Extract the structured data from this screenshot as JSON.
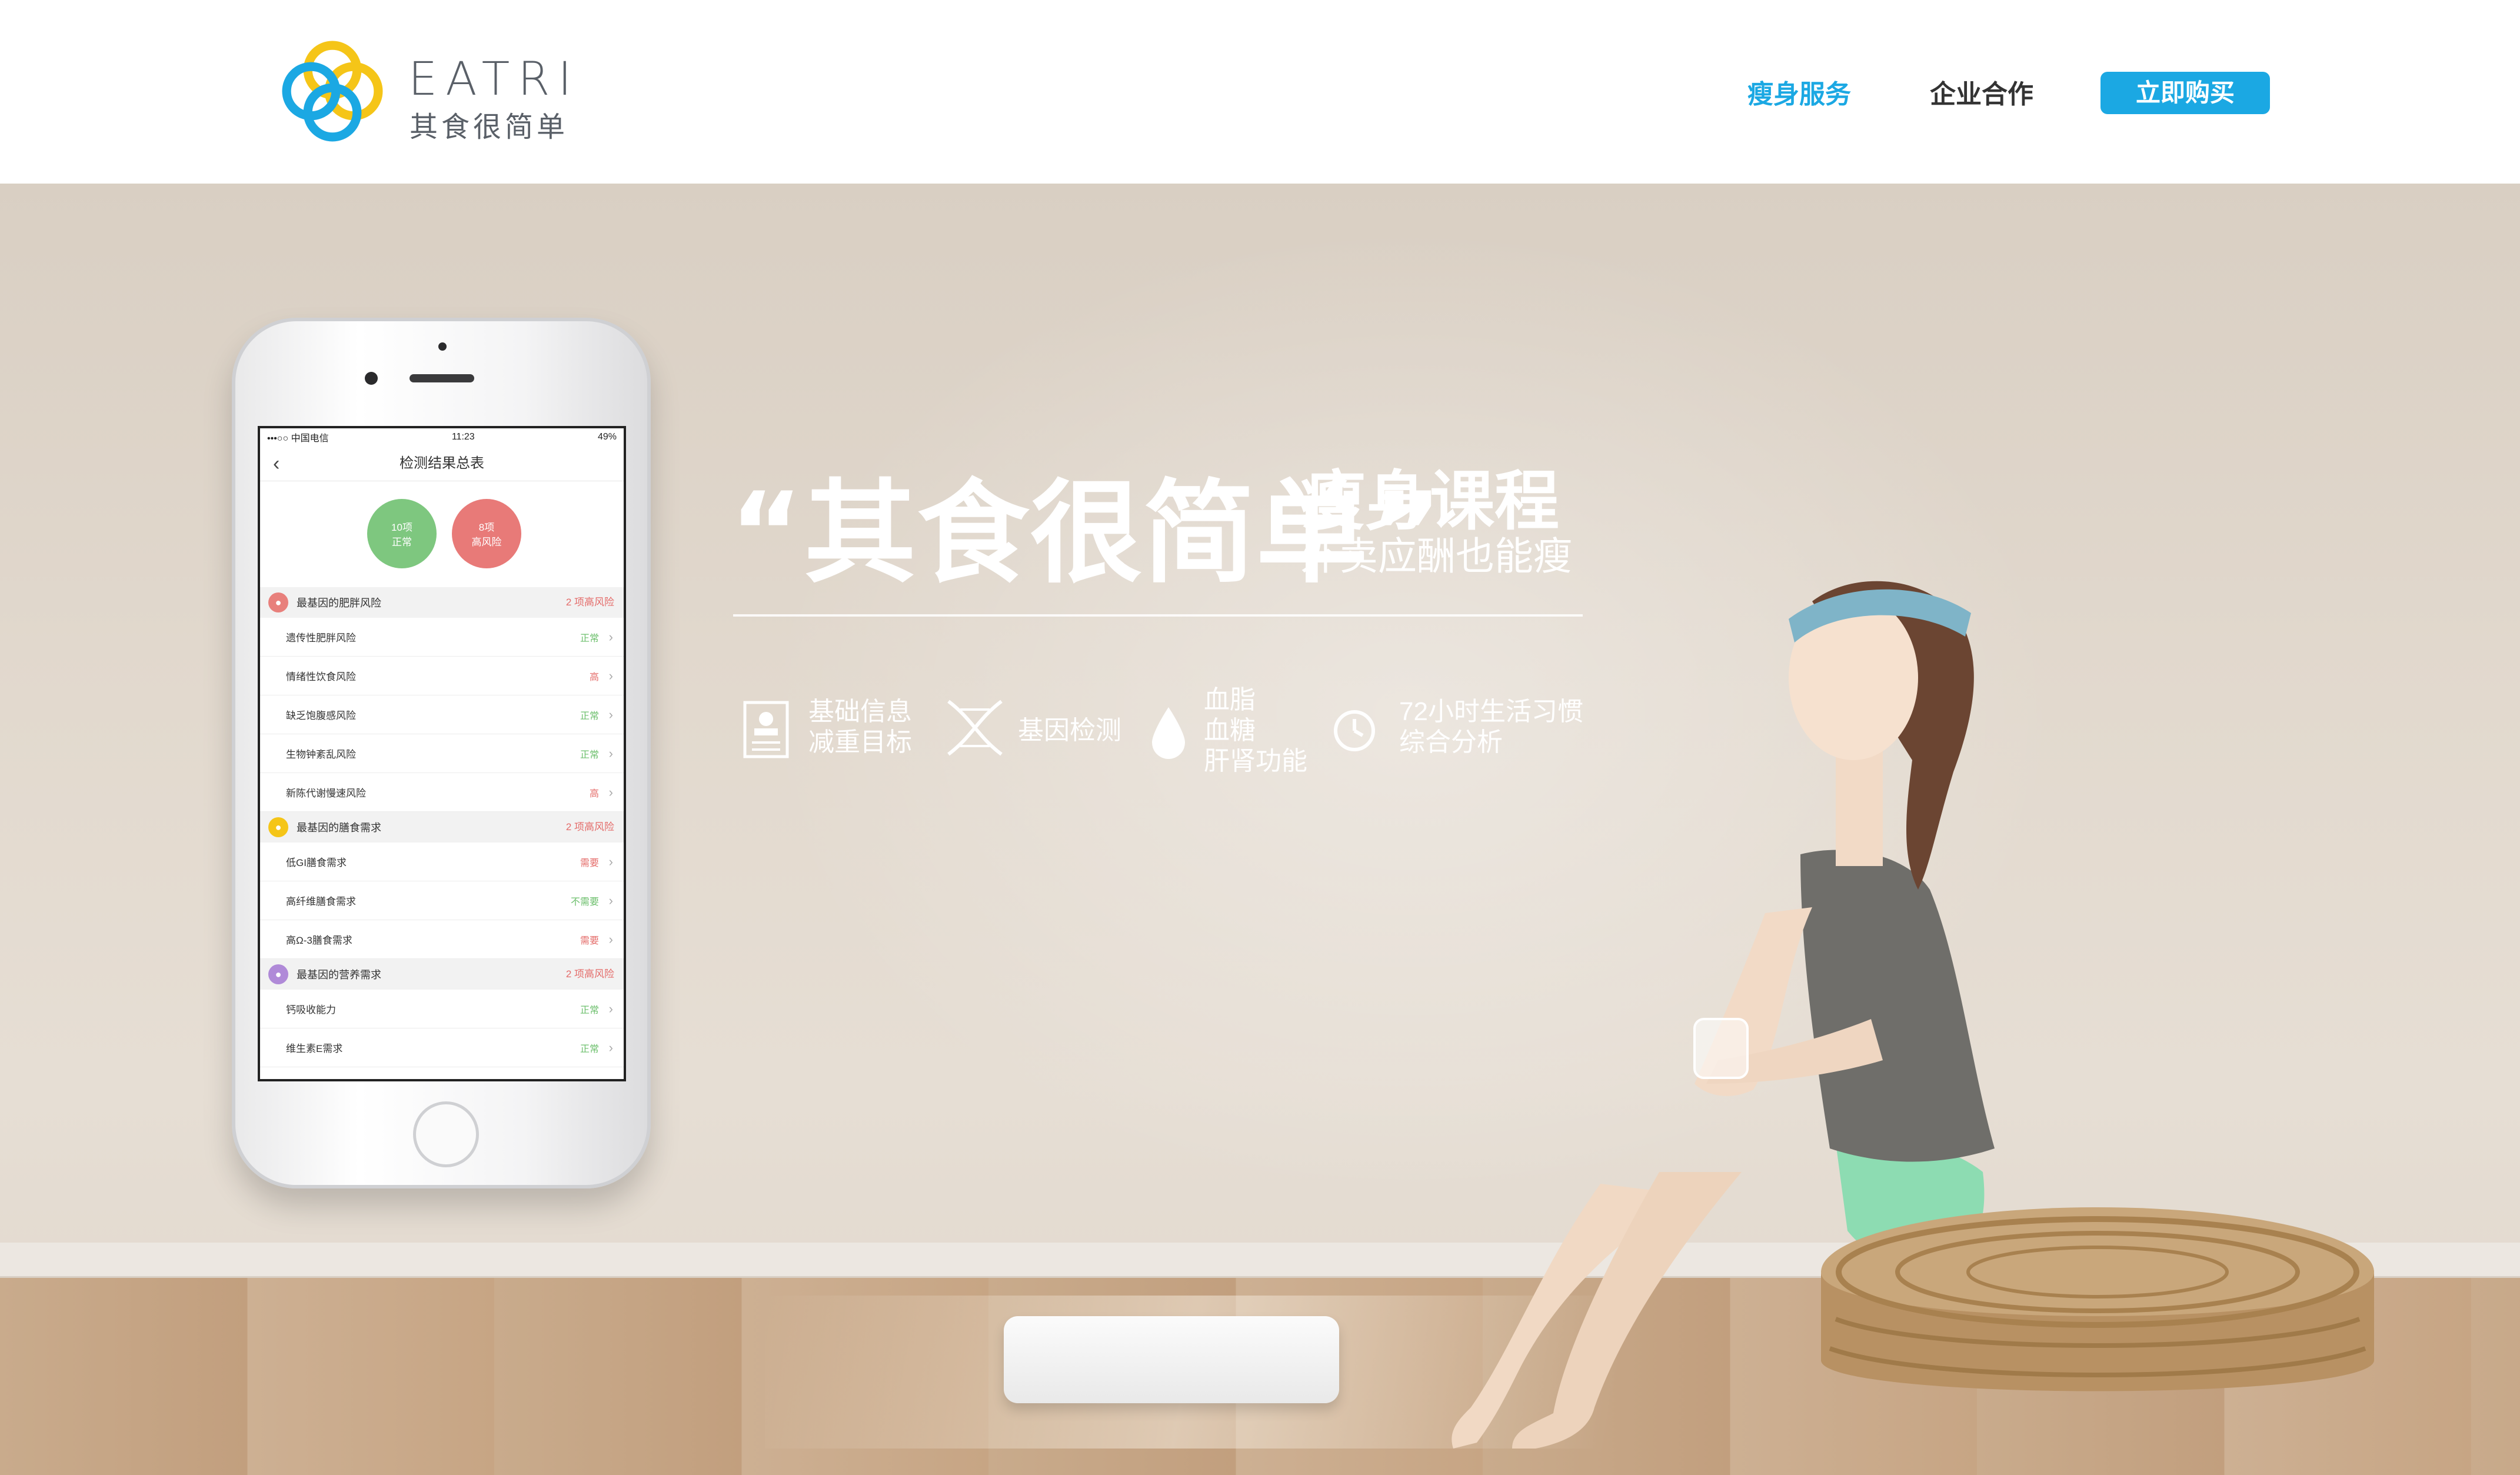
{
  "brand": {
    "name": "EATRI",
    "tagline_cn": "其食很简单",
    "colors": {
      "yellow": "#f5c518",
      "blue": "#1ba8e3"
    }
  },
  "nav": {
    "items": [
      {
        "label": "瘦身服务",
        "active": true
      },
      {
        "label": "企业合作",
        "active": false
      }
    ],
    "buy_button": "立即购买"
  },
  "hero": {
    "headline": "“其食很简单”",
    "course": "瘦身课程",
    "subline": "外卖应酬也能瘦",
    "features": [
      {
        "icon": "profile-card-icon",
        "lines": [
          "基础信息",
          "减重目标"
        ]
      },
      {
        "icon": "dna-icon",
        "lines": [
          "基因检测"
        ]
      },
      {
        "icon": "blood-drop-icon",
        "lines": [
          "血脂",
          "血糖",
          "肝肾功能"
        ]
      },
      {
        "icon": "clock-icon",
        "lines": [
          "72小时生活习惯",
          "综合分析"
        ]
      }
    ]
  },
  "phone": {
    "status": {
      "carrier": "•••○○ 中国电信 ",
      "time": "11:23",
      "battery": "49%"
    },
    "title": "检测结果总表",
    "summary": [
      {
        "line1": "10项",
        "line2": "正常"
      },
      {
        "line1": "8项",
        "line2": "高风险"
      }
    ],
    "sections": [
      {
        "title": "最基因的肥胖风险",
        "risk": "2 项高风险",
        "icon_color": "#e8807c",
        "rows": [
          {
            "label": "遗传性肥胖风险",
            "status": "正常",
            "ok": true
          },
          {
            "label": "情绪性饮食风险",
            "status": "高",
            "ok": false
          },
          {
            "label": "缺乏饱腹感风险",
            "status": "正常",
            "ok": true
          },
          {
            "label": "生物钟紊乱风险",
            "status": "正常",
            "ok": true
          },
          {
            "label": "新陈代谢慢速风险",
            "status": "高",
            "ok": false
          }
        ]
      },
      {
        "title": "最基因的膳食需求",
        "risk": "2 项高风险",
        "icon_color": "#f5c518",
        "rows": [
          {
            "label": "低GI膳食需求",
            "status": "需要",
            "ok": false
          },
          {
            "label": "高纤维膳食需求",
            "status": "不需要",
            "ok": true
          },
          {
            "label": "高Ω-3膳食需求",
            "status": "需要",
            "ok": false
          }
        ]
      },
      {
        "title": "最基因的营养需求",
        "risk": "2 项高风险",
        "icon_color": "#b08ad8",
        "rows": [
          {
            "label": "钙吸收能力",
            "status": "正常",
            "ok": true
          },
          {
            "label": "维生素E需求",
            "status": "正常",
            "ok": true
          }
        ]
      }
    ]
  }
}
